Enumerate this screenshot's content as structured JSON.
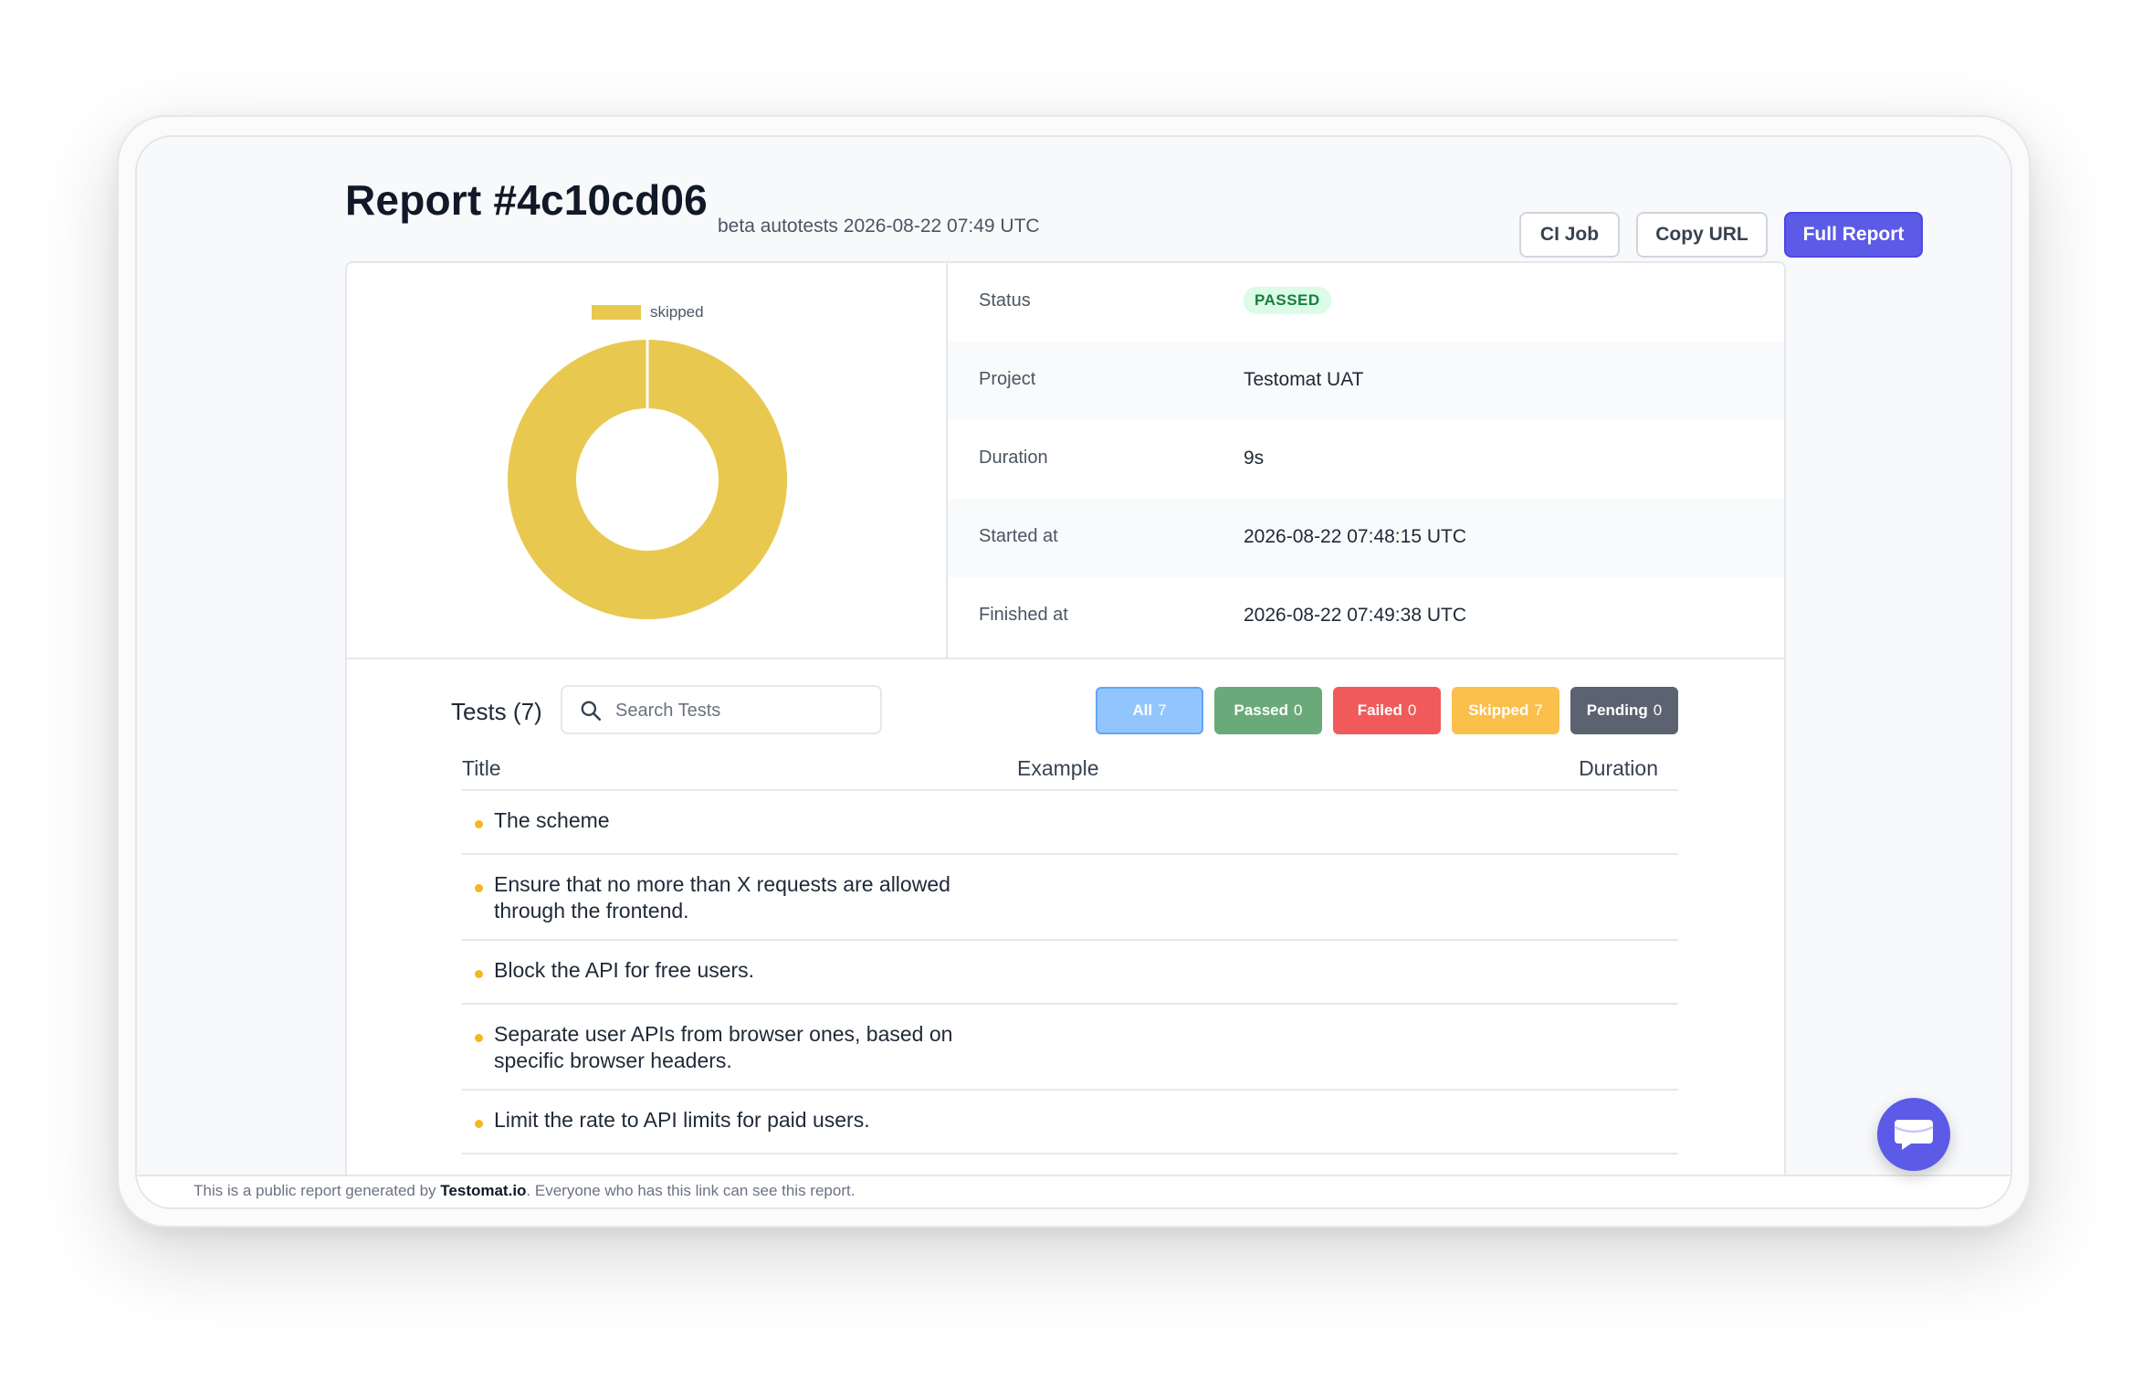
{
  "header": {
    "title": "Report #4c10cd06",
    "subtitle": "beta autotests 2026-08-22 07:49 UTC",
    "buttons": {
      "ci_job": "CI Job",
      "copy_url": "Copy URL",
      "full_report": "Full Report"
    }
  },
  "chart_data": {
    "type": "pie",
    "legend": [
      "skipped"
    ],
    "categories": [
      "skipped"
    ],
    "values": [
      7
    ],
    "colors": [
      "#e9c84f"
    ]
  },
  "info": {
    "status": {
      "label": "Status",
      "value": "PASSED"
    },
    "project": {
      "label": "Project",
      "value": "Testomat UAT"
    },
    "duration": {
      "label": "Duration",
      "value": "9s"
    },
    "started": {
      "label": "Started at",
      "value": "2026-08-22 07:48:15 UTC"
    },
    "finished": {
      "label": "Finished at",
      "value": "2026-08-22 07:49:38 UTC"
    }
  },
  "tests": {
    "heading": "Tests (7)",
    "search_placeholder": "Search Tests",
    "filters": {
      "all": {
        "label": "All",
        "count": "7"
      },
      "passed": {
        "label": "Passed",
        "count": "0"
      },
      "failed": {
        "label": "Failed",
        "count": "0"
      },
      "skipped": {
        "label": "Skipped",
        "count": "7"
      },
      "pending": {
        "label": "Pending",
        "count": "0"
      }
    },
    "columns": {
      "title": "Title",
      "example": "Example",
      "duration": "Duration"
    },
    "rows": [
      {
        "title": "The scheme"
      },
      {
        "title": "Ensure that no more than X requests are allowed through the frontend."
      },
      {
        "title": "Block the API for free users."
      },
      {
        "title": "Separate user APIs from browser ones, based on specific browser headers."
      },
      {
        "title": "Limit the rate to API limits for paid users."
      }
    ]
  },
  "footer": {
    "prefix": "This is a public report generated by",
    "brand": "Testomat.io",
    "suffix": ". Everyone who has this link can see this report."
  }
}
